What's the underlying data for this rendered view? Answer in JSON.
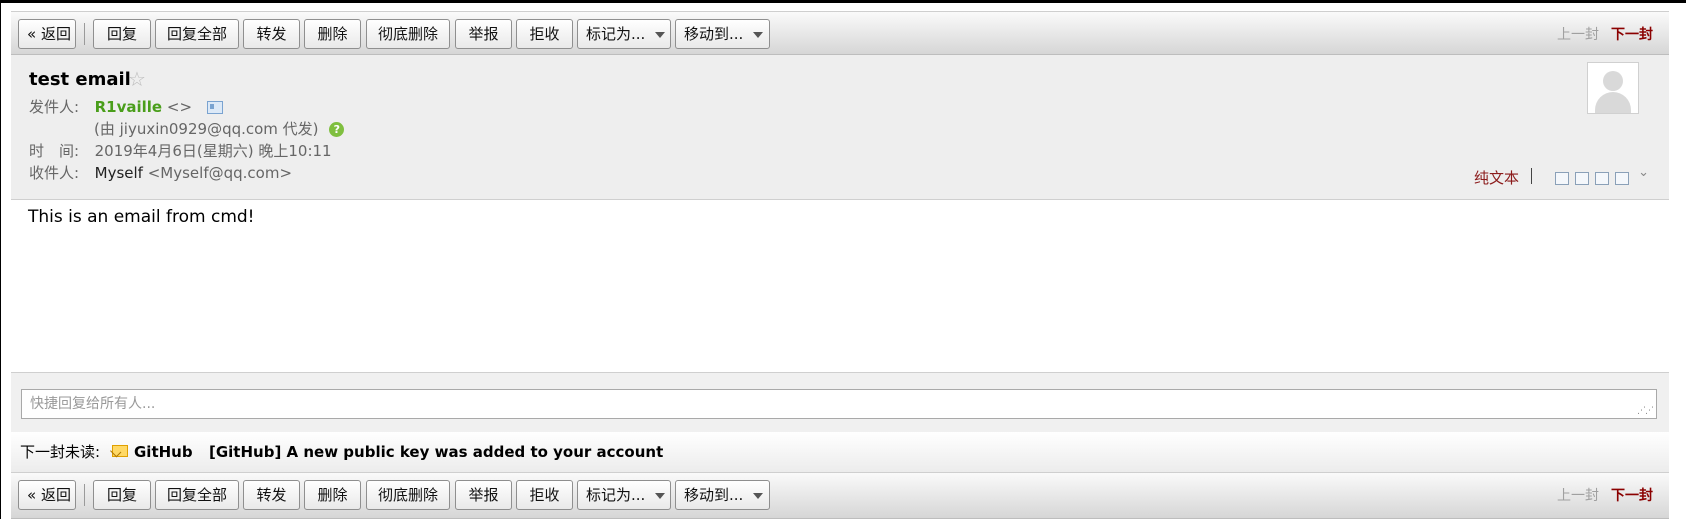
{
  "toolbar": {
    "back": "« 返回",
    "reply": "回复",
    "reply_all": "回复全部",
    "forward": "转发",
    "delete": "删除",
    "delete_permanently": "彻底删除",
    "report": "举报",
    "reject": "拒收",
    "mark_as": "标记为...",
    "move_to": "移动到...",
    "prev": "上一封",
    "next": "下一封"
  },
  "email": {
    "subject": "test email",
    "sender_label": "发件人:",
    "sender_name": "R1vaille",
    "sender_addr": "<>",
    "proxy_text": "(由 jiyuxin0929@qq.com 代发)",
    "time_label": "时　间:",
    "time": "2019年4月6日(星期六) 晚上10:11",
    "recipient_label": "收件人:",
    "recipient_name": "Myself",
    "recipient_addr": "<Myself@qq.com>",
    "plain_text_link": "纯文本",
    "body": "This is an email from cmd!"
  },
  "quick_reply": {
    "placeholder": "快捷回复给所有人..."
  },
  "next_unread": {
    "label": "下一封未读:",
    "from": "GitHub",
    "subject": "[GitHub] A new public key was added to your account"
  },
  "colors": {
    "sender_green": "#4a9e1b",
    "link_red": "#8b1a1a",
    "toolbar_gradient_top": "#fafafa",
    "toolbar_gradient_bottom": "#d6d6d6"
  },
  "icons": [
    "star-icon",
    "contact-card-icon",
    "help-icon",
    "avatar-icon",
    "envelope-icon",
    "more-chevron-icon"
  ]
}
